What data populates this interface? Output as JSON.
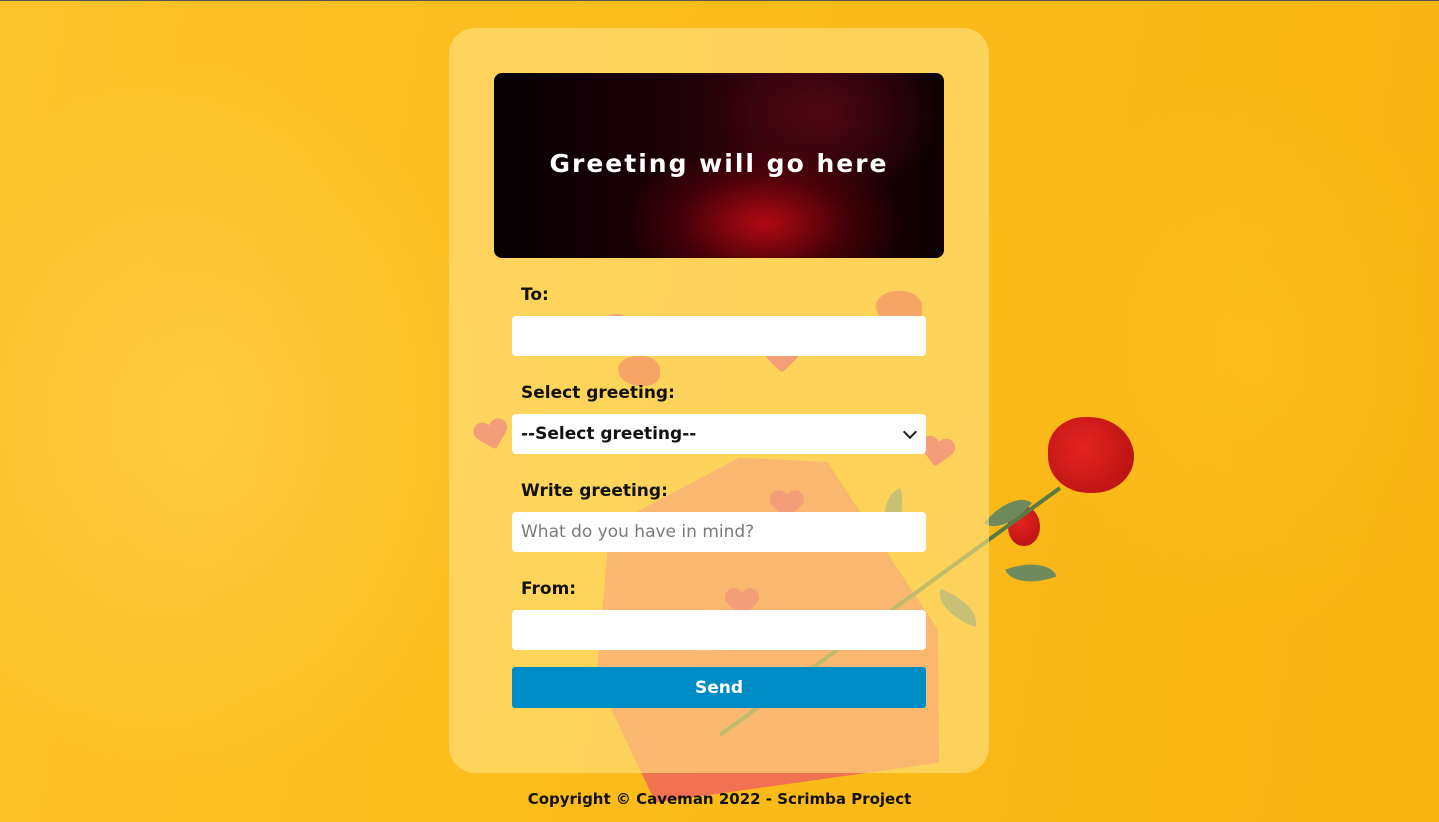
{
  "display": {
    "greeting_text": "Greeting will go here"
  },
  "form": {
    "to_label": "To:",
    "to_value": "",
    "select_label": "Select greeting:",
    "select_value": "--Select greeting--",
    "write_label": "Write greeting:",
    "write_placeholder": "What do you have in mind?",
    "from_label": "From:",
    "from_value": "",
    "send_label": "Send"
  },
  "footer": {
    "text": "Copyright © Caveman 2022 - Scrimba Project"
  },
  "colors": {
    "background": "#fbbd1c",
    "send_button": "#008cc4",
    "card": "rgba(255,226,130,0.62)"
  },
  "icons": {
    "select_caret": "chevron-down-icon"
  }
}
